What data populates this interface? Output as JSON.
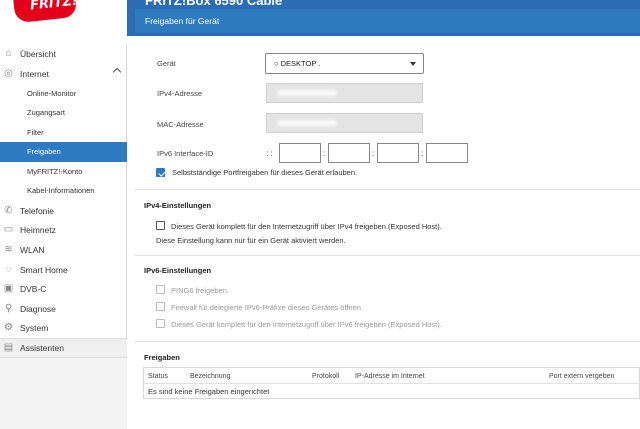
{
  "header": {
    "logo_text": "FRITZ!",
    "title": "FRITZ!Box 6590 Cable",
    "subtitle": "Freigaben für Gerät"
  },
  "sidebar": {
    "items": [
      {
        "label": "Übersicht",
        "icon": "home-icon"
      },
      {
        "label": "Internet",
        "icon": "globe-icon"
      },
      {
        "label": "Online-Monitor"
      },
      {
        "label": "Zugangsart"
      },
      {
        "label": "Filter"
      },
      {
        "label": "Freigaben"
      },
      {
        "label": "MyFRITZ!-Konto"
      },
      {
        "label": "Kabel-Informationen"
      },
      {
        "label": "Telefonie",
        "icon": "phone-icon"
      },
      {
        "label": "Heimnetz",
        "icon": "network-icon"
      },
      {
        "label": "WLAN",
        "icon": "wifi-icon"
      },
      {
        "label": "Smart Home",
        "icon": "smarthome-icon"
      },
      {
        "label": "DVB-C",
        "icon": "tv-icon"
      },
      {
        "label": "Diagnose",
        "icon": "diagnose-icon"
      },
      {
        "label": "System",
        "icon": "gear-icon"
      },
      {
        "label": "Assistenten",
        "icon": "assistant-icon"
      }
    ]
  },
  "form": {
    "device_label": "Gerät",
    "device_value": "○ DESKTOP   .",
    "ipv4_label": "IPv4-Adresse",
    "mac_label": "MAC-Adresse",
    "ipv6_label": "IPv6 Interface-ID",
    "ipv6_prefix": ": :",
    "colon": ":",
    "self_portfw_label": "Selbstständige Portfreigaben für dieses Gerät erlauben."
  },
  "ipv4_section": {
    "title": "IPv4-Einstellungen",
    "exposed_host_label": "Dieses Gerät komplett für den Internetzugriff über IPv4 freigeben (Exposed Host).",
    "note": "Diese Einstellung kann nur für ein Gerät aktiviert werden."
  },
  "ipv6_section": {
    "title": "IPv6-Einstellungen",
    "ping6_label": "PING6 freigeben.",
    "firewall_label": "Firewall für delegierte IPv6-Präfixe dieses Gerätes öffnen.",
    "exposed_host_label": "Dieses Gerät komplett für den Internetzugriff über IPv6 freigeben (Exposed Host)."
  },
  "freigaben": {
    "title": "Freigaben",
    "columns": [
      "Status",
      "Bezeichnung",
      "Protokoll",
      "IP-Adresse im Internet",
      "Port extern vergeben"
    ],
    "empty_text": "Es sind keine Freigaben eingerichtet"
  }
}
